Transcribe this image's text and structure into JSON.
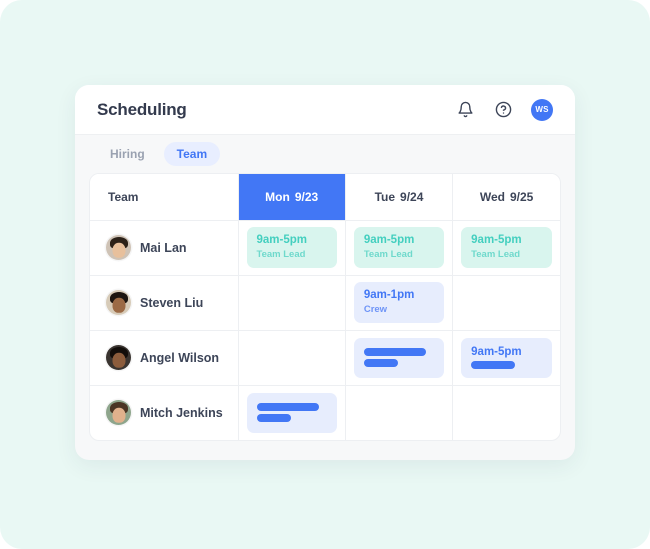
{
  "app": {
    "title": "Scheduling",
    "accent_blue": "#4277f5",
    "accent_green": "#43cfbf",
    "background": "#e9f8f4"
  },
  "header": {
    "icons": [
      {
        "name": "bell-icon",
        "label": "Notifications"
      },
      {
        "name": "help-icon",
        "label": "Help"
      }
    ],
    "avatar_initials": "WS"
  },
  "tabs": [
    {
      "label": "Hiring",
      "active": false
    },
    {
      "label": "Team",
      "active": true
    }
  ],
  "table": {
    "columns": [
      {
        "label": "Team",
        "today": false
      },
      {
        "day": "Mon",
        "date": "9/23",
        "today": true
      },
      {
        "day": "Tue",
        "date": "9/24",
        "today": false
      },
      {
        "day": "Wed",
        "date": "9/25",
        "today": false
      }
    ],
    "rows": [
      {
        "name": "Mai Lan",
        "cells": [
          {
            "type": "shift",
            "color": "green",
            "time": "9am-5pm",
            "role": "Team Lead"
          },
          {
            "type": "shift",
            "color": "green",
            "time": "9am-5pm",
            "role": "Team Lead"
          },
          {
            "type": "shift",
            "color": "green",
            "time": "9am-5pm",
            "role": "Team Lead"
          }
        ]
      },
      {
        "name": "Steven Liu",
        "cells": [
          {
            "type": "empty"
          },
          {
            "type": "shift",
            "color": "blue",
            "time": "9am-1pm",
            "role": "Crew"
          },
          {
            "type": "empty"
          }
        ]
      },
      {
        "name": "Angel Wilson",
        "cells": [
          {
            "type": "empty"
          },
          {
            "type": "placeholder",
            "color": "blue",
            "bars": [
              "long",
              "short"
            ]
          },
          {
            "type": "shift",
            "color": "blue",
            "time": "9am-5pm",
            "role": "",
            "bars": [
              "mid"
            ]
          }
        ]
      },
      {
        "name": "Mitch Jenkins",
        "cells": [
          {
            "type": "placeholder",
            "color": "blue",
            "bars": [
              "long",
              "short"
            ]
          },
          {
            "type": "empty"
          },
          {
            "type": "empty"
          }
        ]
      }
    ]
  }
}
